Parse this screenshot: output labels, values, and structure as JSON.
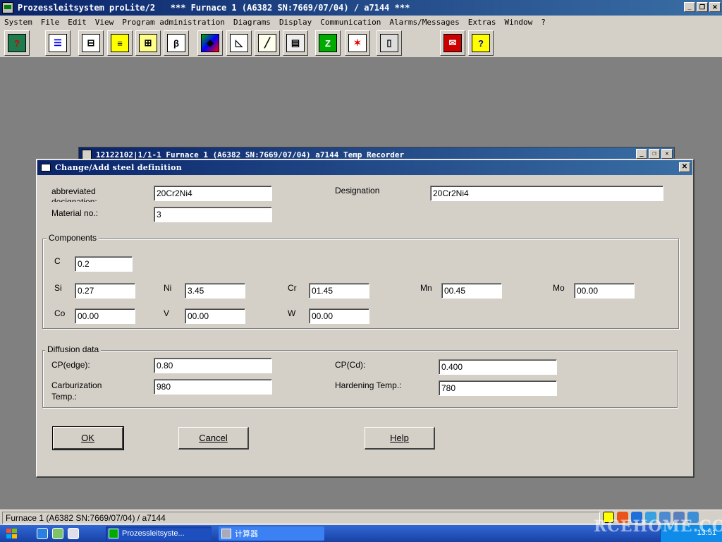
{
  "app": {
    "title": "Prozessleitsystem proLite/2   *** Furnace 1 (A6382 SN:7669/07/04) / a7144 ***",
    "minimize": "_",
    "restore": "❐",
    "close": "✕"
  },
  "menu": [
    "System",
    "File",
    "Edit",
    "View",
    "Program administration",
    "Diagrams",
    "Display",
    "Communication",
    "Alarms/Messages",
    "Extras",
    "Window",
    "?"
  ],
  "toolbar_icons": [
    "disk-help-icon",
    "tree-view-icon",
    "network-icon",
    "notes-icon",
    "settings-list-icon",
    "diagram-beta-icon",
    "color-palette-icon",
    "chart-icon",
    "trend-chart-icon",
    "file-cabinet-icon",
    "flow-chart-icon",
    "alarm-icon",
    "device-icon",
    "printer-mail-icon",
    "help-book-icon"
  ],
  "recorder_window": {
    "title": "12122102|1/1-1 Furnace 1 (A6382 SN:7669/07/04) a7144 Temp Recorder"
  },
  "dialog": {
    "title": "Change/Add steel definition",
    "close": "✕",
    "abbrev_label": "abbreviated designation:",
    "abbrev_value": "20Cr2Ni4",
    "designation_label": "Designation",
    "designation_value": "20Cr2Ni4",
    "material_label": "Material no.:",
    "material_value": "3",
    "components": {
      "title": "Components",
      "c_label": "C",
      "c_value": "0.2",
      "si_label": "Si",
      "si_value": "0.27",
      "ni_label": "Ni",
      "ni_value": "3.45",
      "cr_label": "Cr",
      "cr_value": "01.45",
      "mn_label": "Mn",
      "mn_value": "00.45",
      "mo_label": "Mo",
      "mo_value": "00.00",
      "co_label": "Co",
      "co_value": "00.00",
      "v_label": "V",
      "v_value": "00.00",
      "w_label": "W",
      "w_value": "00.00"
    },
    "diffusion": {
      "title": "Diffusion data",
      "cp_edge_label": "CP(edge):",
      "cp_edge_value": "0.80",
      "cp_cd_label": "CP(Cd):",
      "cp_cd_value": "0.400",
      "carb_label_1": "Carburization",
      "carb_label_2": "Temp.:",
      "carb_value": "980",
      "hardening_label": "Hardening Temp.:",
      "hardening_value": "780"
    },
    "ok": "OK",
    "cancel": "Cancel",
    "help": "Help"
  },
  "status": {
    "text": "Furnace 1 (A6382 SN:7669/07/04) / a7144"
  },
  "taskbar": {
    "tasks": [
      "Prozessleitsyste...",
      "计算器"
    ],
    "clock": "13:51"
  },
  "watermark": "RCEHOME.COM"
}
